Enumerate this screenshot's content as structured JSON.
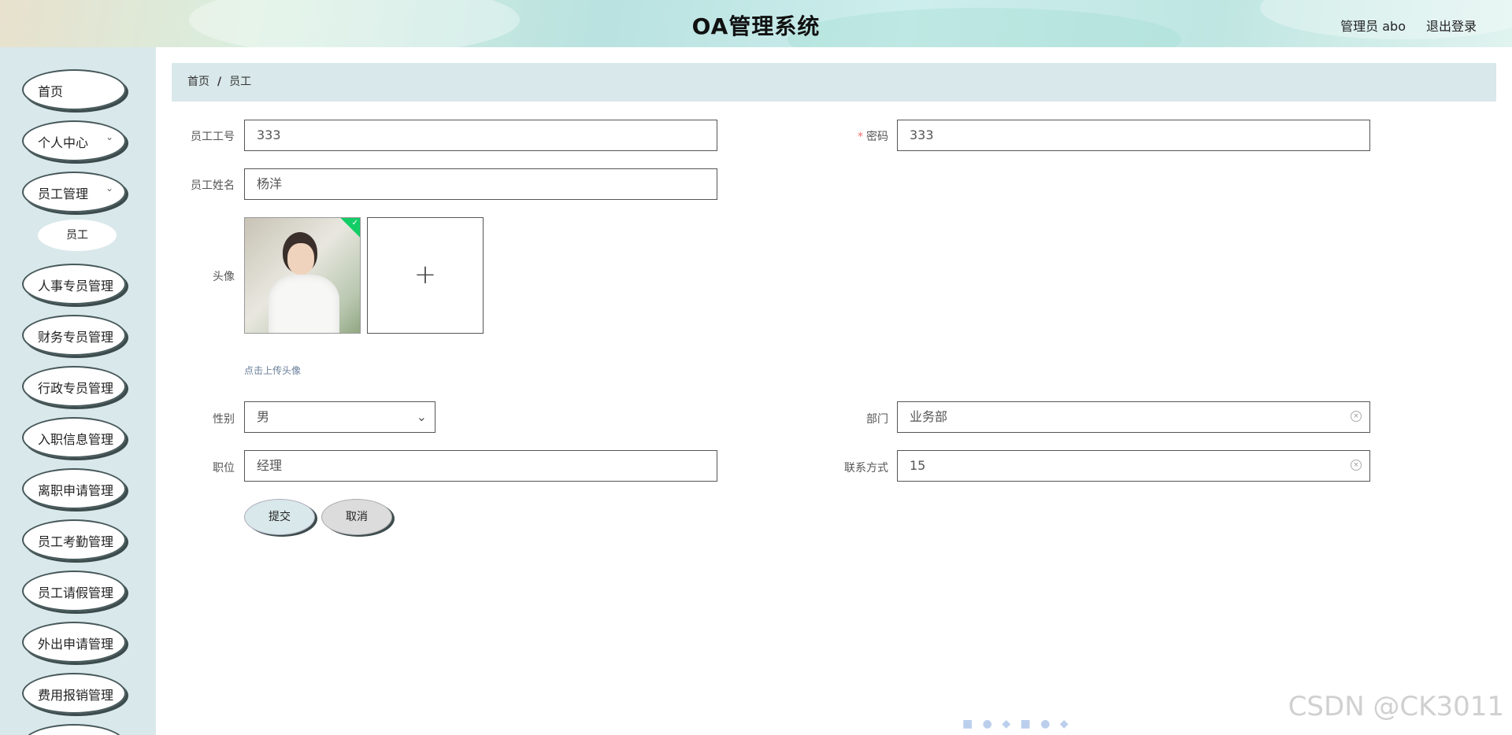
{
  "header": {
    "title": "OA管理系统",
    "user_info": "管理员 abo",
    "logout": "退出登录"
  },
  "sidebar": {
    "items": [
      {
        "label": "首页",
        "has_children": false
      },
      {
        "label": "个人中心",
        "has_children": true
      },
      {
        "label": "员工管理",
        "has_children": true
      },
      {
        "label": "人事专员管理",
        "has_children": false
      },
      {
        "label": "财务专员管理",
        "has_children": false
      },
      {
        "label": "行政专员管理",
        "has_children": false
      },
      {
        "label": "入职信息管理",
        "has_children": false
      },
      {
        "label": "离职申请管理",
        "has_children": false
      },
      {
        "label": "员工考勤管理",
        "has_children": false
      },
      {
        "label": "员工请假管理",
        "has_children": false
      },
      {
        "label": "外出申请管理",
        "has_children": false
      },
      {
        "label": "费用报销管理",
        "has_children": false
      }
    ],
    "submenu_item": "员工"
  },
  "breadcrumb": {
    "home": "首页",
    "separator": "/",
    "current": "员工"
  },
  "form": {
    "employee_id": {
      "label": "员工工号",
      "value": "333"
    },
    "password": {
      "label": "密码",
      "required_mark": "*",
      "value": "333"
    },
    "employee_name": {
      "label": "员工姓名",
      "value": "杨洋"
    },
    "avatar": {
      "label": "头像",
      "upload_plus": "+",
      "tip": "点击上传头像"
    },
    "gender": {
      "label": "性别",
      "value": "男"
    },
    "department": {
      "label": "部门",
      "value": "业务部"
    },
    "position": {
      "label": "职位",
      "value": "经理"
    },
    "contact": {
      "label": "联系方式",
      "value": "15"
    },
    "submit": "提交",
    "cancel": "取消"
  },
  "watermark": "CSDN @CK3011",
  "colors": {
    "sidebar_bg": "#d9e8ea",
    "breadcrumb_bg": "#d9e8ea",
    "required": "#f56c6c",
    "upload_success": "#13ce66"
  }
}
